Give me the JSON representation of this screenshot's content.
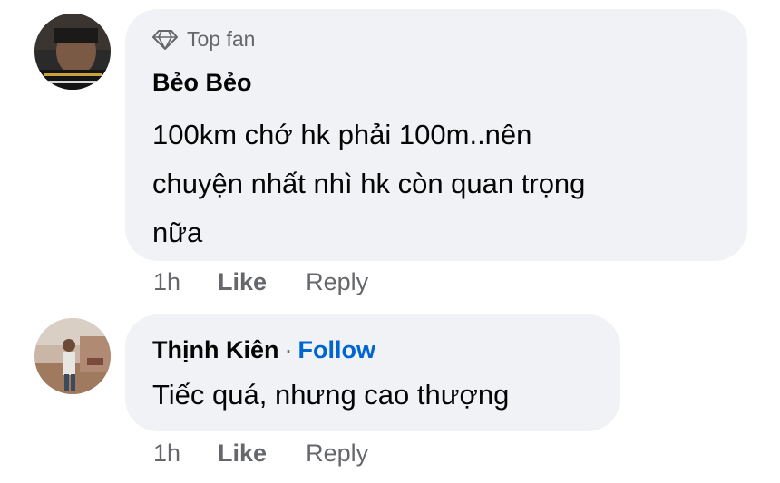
{
  "comments": [
    {
      "badge": "Top fan",
      "author": "Bẻo Bẻo",
      "text_lines": [
        "100km chớ hk phải 100m..nên",
        "chuyện nhất nhì hk còn quan trọng",
        "nữa"
      ],
      "time": "1h",
      "like": "Like",
      "reply": "Reply"
    },
    {
      "author": "Thịnh Kiên",
      "separator": "·",
      "follow": "Follow",
      "text": "Tiếc quá, nhưng cao thượng",
      "time": "1h",
      "like": "Like",
      "reply": "Reply"
    }
  ],
  "colors": {
    "bubble": "#f0f2f5",
    "secondary_text": "#65676b",
    "follow_link": "#0064d1"
  },
  "icons": {
    "top_fan_badge": "diamond-icon"
  }
}
